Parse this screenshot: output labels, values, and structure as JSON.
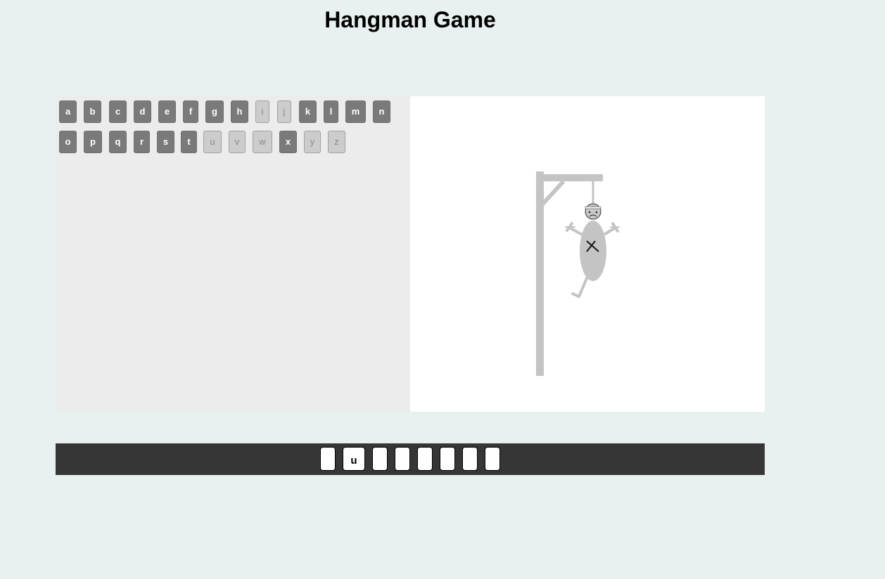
{
  "title": "Hangman Game",
  "colors": {
    "page_background": "#e8f0f0",
    "key_active": "#7a7a7a",
    "key_used": "#cccccc",
    "gallows": "#c4c4c4",
    "word_bar": "#363636"
  },
  "keyboard": {
    "row1": [
      {
        "letter": "a",
        "used": false
      },
      {
        "letter": "b",
        "used": false
      },
      {
        "letter": "c",
        "used": false
      },
      {
        "letter": "d",
        "used": false
      },
      {
        "letter": "e",
        "used": false
      },
      {
        "letter": "f",
        "used": false
      },
      {
        "letter": "g",
        "used": false
      },
      {
        "letter": "h",
        "used": false
      },
      {
        "letter": "i",
        "used": true
      },
      {
        "letter": "j",
        "used": true
      },
      {
        "letter": "k",
        "used": false
      },
      {
        "letter": "l",
        "used": false
      },
      {
        "letter": "m",
        "used": false
      },
      {
        "letter": "n",
        "used": false
      }
    ],
    "row2": [
      {
        "letter": "o",
        "used": false
      },
      {
        "letter": "p",
        "used": false
      },
      {
        "letter": "q",
        "used": false
      },
      {
        "letter": "r",
        "used": false
      },
      {
        "letter": "s",
        "used": false
      },
      {
        "letter": "t",
        "used": false
      },
      {
        "letter": "u",
        "used": true
      },
      {
        "letter": "v",
        "used": true
      },
      {
        "letter": "w",
        "used": true
      },
      {
        "letter": "x",
        "used": false
      },
      {
        "letter": "y",
        "used": true
      },
      {
        "letter": "z",
        "used": true
      }
    ]
  },
  "hangman": {
    "parts_shown": [
      "gallows",
      "rope",
      "head",
      "body",
      "left-arm",
      "right-arm",
      "left-leg"
    ]
  },
  "word": {
    "slots": [
      "",
      "u",
      "",
      "",
      "",
      "",
      "",
      ""
    ]
  }
}
